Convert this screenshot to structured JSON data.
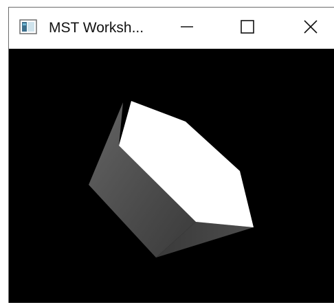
{
  "window": {
    "title": "MST Worksh...",
    "icons": {
      "app": "app-window-icon",
      "minimize": "minimize-icon",
      "maximize": "maximize-icon",
      "close": "close-icon"
    }
  },
  "viewport": {
    "background": "#000000",
    "object": "rotated-hexagonal-prism",
    "colors": {
      "top_face": "#ffffff",
      "side_face_light": "#5a5a5a",
      "side_face_dark": "#3e3e3e"
    }
  }
}
